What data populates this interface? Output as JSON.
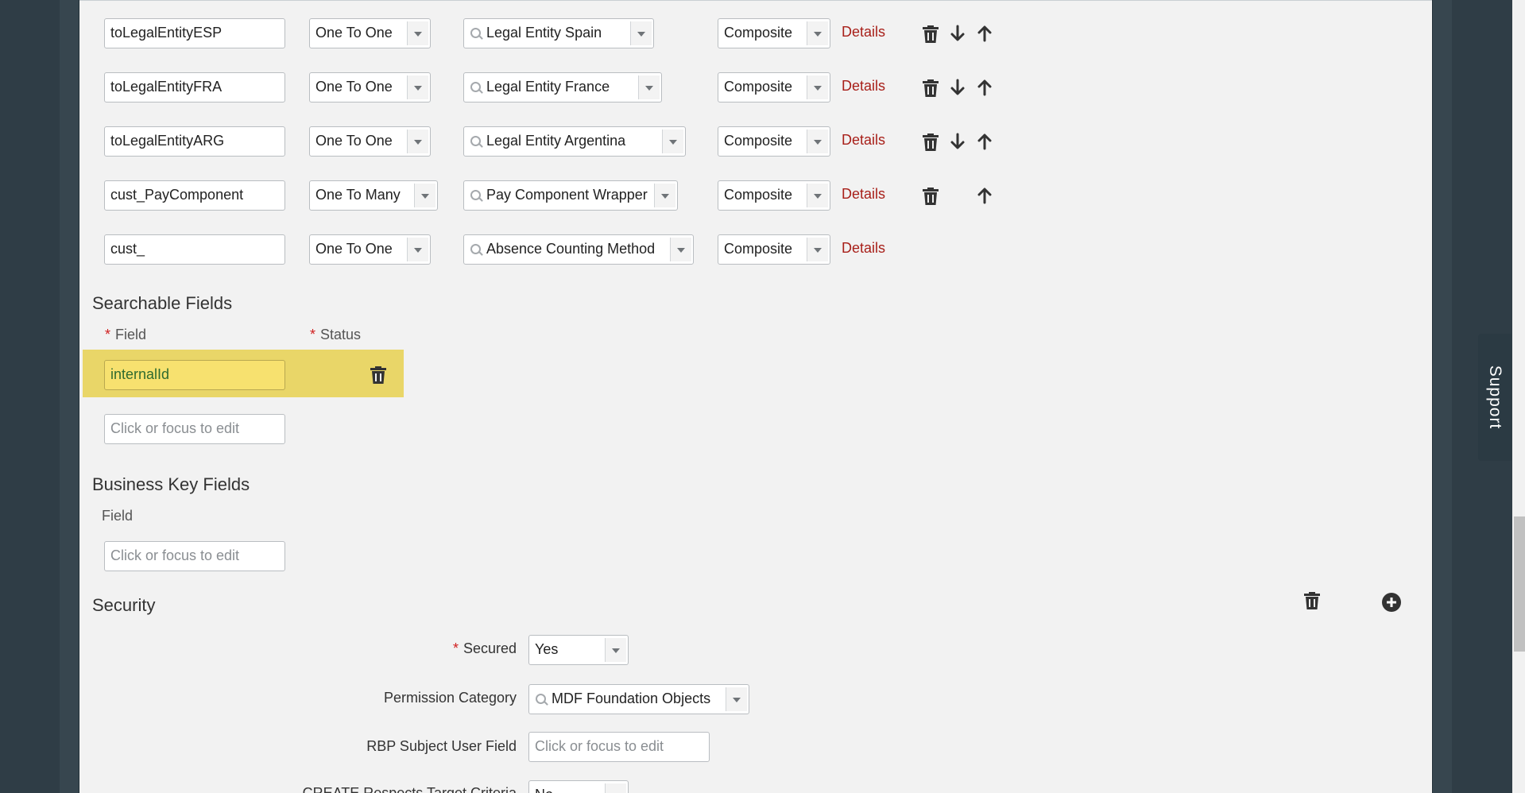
{
  "associations": [
    {
      "name": "toLegalEntityESP",
      "multiplicity": "One To One",
      "destination": "Legal Entity Spain",
      "type": "Composite",
      "details": "Details",
      "actions": [
        "delete",
        "down",
        "up"
      ]
    },
    {
      "name": "toLegalEntityFRA",
      "multiplicity": "One To One",
      "destination": "Legal Entity France",
      "type": "Composite",
      "details": "Details",
      "actions": [
        "delete",
        "down",
        "up"
      ]
    },
    {
      "name": "toLegalEntityARG",
      "multiplicity": "One To One",
      "destination": "Legal Entity Argentina",
      "type": "Composite",
      "details": "Details",
      "actions": [
        "delete",
        "down",
        "up"
      ]
    },
    {
      "name": "cust_PayComponent",
      "multiplicity": "One To Many",
      "destination": "Pay Component Wrapper",
      "type": "Composite",
      "details": "Details",
      "actions": [
        "delete",
        "up"
      ]
    },
    {
      "name": "cust_",
      "multiplicity": "One To One",
      "destination": "Absence Counting Method",
      "type": "Composite",
      "details": "Details",
      "actions": []
    }
  ],
  "searchable": {
    "title": "Searchable Fields",
    "field_label": "Field",
    "status_label": "Status",
    "row_value": "internalId",
    "new_placeholder": "Click or focus to edit"
  },
  "business_key": {
    "title": "Business Key Fields",
    "field_label": "Field",
    "new_placeholder": "Click or focus to edit"
  },
  "security": {
    "title": "Security",
    "secured_label": "Secured",
    "secured_value": "Yes",
    "permission_label": "Permission Category",
    "permission_value": "MDF Foundation Objects",
    "rbp_label": "RBP Subject User Field",
    "rbp_placeholder": "Click or focus to edit",
    "create_label": "CREATE Respects Target Criteria",
    "create_value": "No"
  },
  "support_label": "Support",
  "colors": {
    "accent_link": "#a8201a",
    "highlight": "#e9d668",
    "required": "#d01e1e"
  },
  "icons": [
    "trash-icon",
    "arrow-down-icon",
    "arrow-up-icon",
    "plus-circle-icon",
    "search-icon",
    "chevron-down-icon"
  ]
}
